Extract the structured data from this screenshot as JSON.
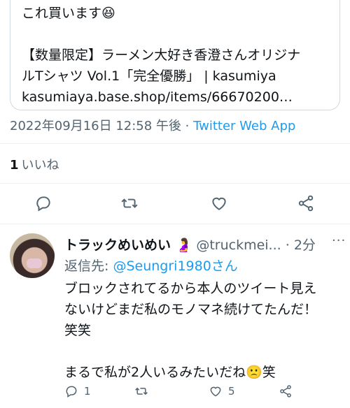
{
  "card": {
    "line1": "これ買います😆",
    "line2": "【数量限定】ラーメン大好き香澄さんオリジナ",
    "line3": "ルTシャツ Vol.1「完全優勝」 | kasumiya",
    "line4": "kasumiaya.base.shop/items/66670200…"
  },
  "meta": {
    "datetime": "2022年09月16日 12:58 午後",
    "separator": " · ",
    "app": "Twitter Web App"
  },
  "likes": {
    "count": "1",
    "label": "いいね"
  },
  "actions": [
    "reply-icon",
    "retweet-icon",
    "like-icon",
    "share-icon"
  ],
  "reply": {
    "name": "トラックめいめい 🤰",
    "handle": "@truckmei...",
    "time": "· 2分",
    "menu": "···",
    "to_prefix": "返信先: ",
    "to_user": "@Seungri1980さん",
    "body1": "ブロックされてるから本人のツイート見え",
    "body2": "ないけどまだ私のモノマネ続けてたんだ！",
    "body3": "笑笑",
    "body4": "まるで私が2人いるみたいだね🙁笑",
    "reply_count": "1",
    "retweet_count": "",
    "like_count": "5"
  },
  "colors": {
    "link": "#1d9bf0",
    "muted": "#536471",
    "text": "#0f1419"
  }
}
